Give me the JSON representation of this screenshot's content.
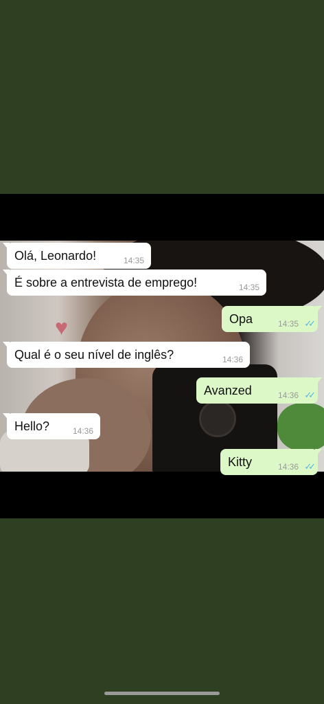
{
  "colors": {
    "background": "#2f3f22",
    "incoming_bubble": "#ffffff",
    "outgoing_bubble": "#dcf8c6",
    "read_ticks": "#4fb6ec"
  },
  "chat": {
    "messages": [
      {
        "direction": "incoming",
        "text": "Olá, Leonardo!",
        "time": "14:35"
      },
      {
        "direction": "incoming",
        "text": "É sobre a entrevista de emprego!",
        "time": "14:35"
      },
      {
        "direction": "outgoing",
        "text": "Opa",
        "time": "14:35",
        "status": "read"
      },
      {
        "direction": "incoming",
        "text": "Qual é o seu nível de inglês?",
        "time": "14:36"
      },
      {
        "direction": "outgoing",
        "text": "Avanzed",
        "time": "14:36",
        "status": "read"
      },
      {
        "direction": "incoming",
        "text": "Hello?",
        "time": "14:36"
      },
      {
        "direction": "outgoing",
        "text": "Kitty",
        "time": "14:36",
        "status": "read"
      }
    ]
  },
  "icons": {
    "read_receipt": "double-check-icon",
    "heart": "heart-icon"
  }
}
